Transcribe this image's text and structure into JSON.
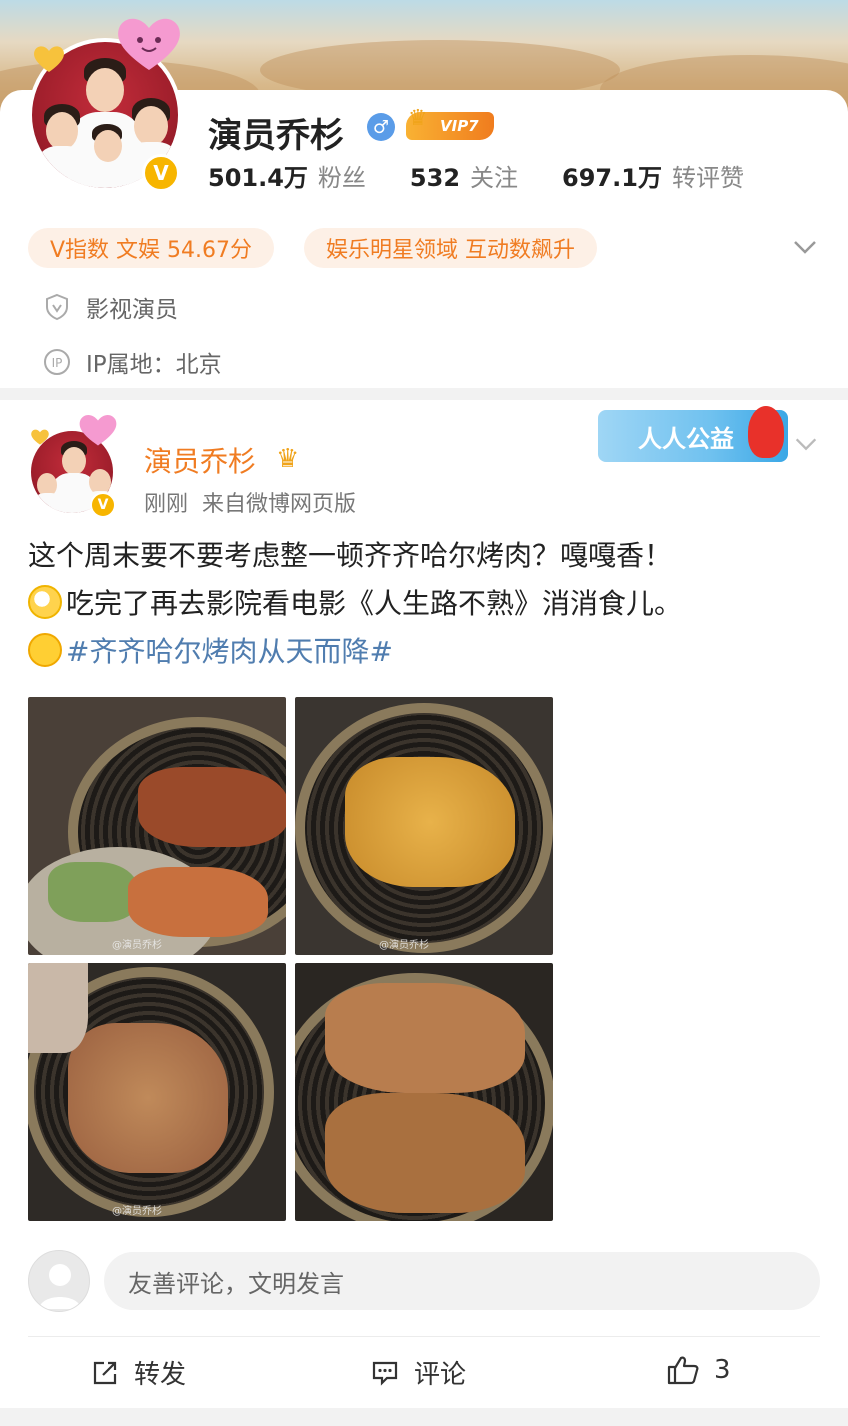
{
  "profile": {
    "name": "演员乔杉",
    "gender_icon": "male-icon",
    "vip_label": "VIP7",
    "stats": [
      {
        "num": "501.4万",
        "label": "粉丝"
      },
      {
        "num": "532",
        "label": "关注"
      },
      {
        "num": "697.1万",
        "label": "转评赞"
      }
    ],
    "pills": [
      "V指数 文娱 54.67分",
      "娱乐明星领域 互动数飙升"
    ],
    "occupation": "影视演员",
    "ip_location": "IP属地：北京"
  },
  "post": {
    "author": "演员乔杉",
    "meta": "刚刚  来自微博网页版",
    "charity_badge": "人人公益",
    "text_line1": "这个周末要不要考虑整一顿齐齐哈尔烤肉？嘎嘎香！",
    "text_line2": "吃完了再去影院看电影《人生路不熟》消消食儿。",
    "hashtag": "#齐齐哈尔烤肉从天而降#",
    "watermarks": [
      "@演员乔杉",
      "@演员乔杉",
      "@演员乔杉"
    ]
  },
  "comment": {
    "placeholder": "友善评论，文明发言"
  },
  "actions": {
    "repost": "转发",
    "comment": "评论",
    "like_count": "3"
  },
  "colors": {
    "accent_orange": "#f07c22",
    "hashtag_blue": "#507daf",
    "pill_bg": "#fdf0e6"
  }
}
